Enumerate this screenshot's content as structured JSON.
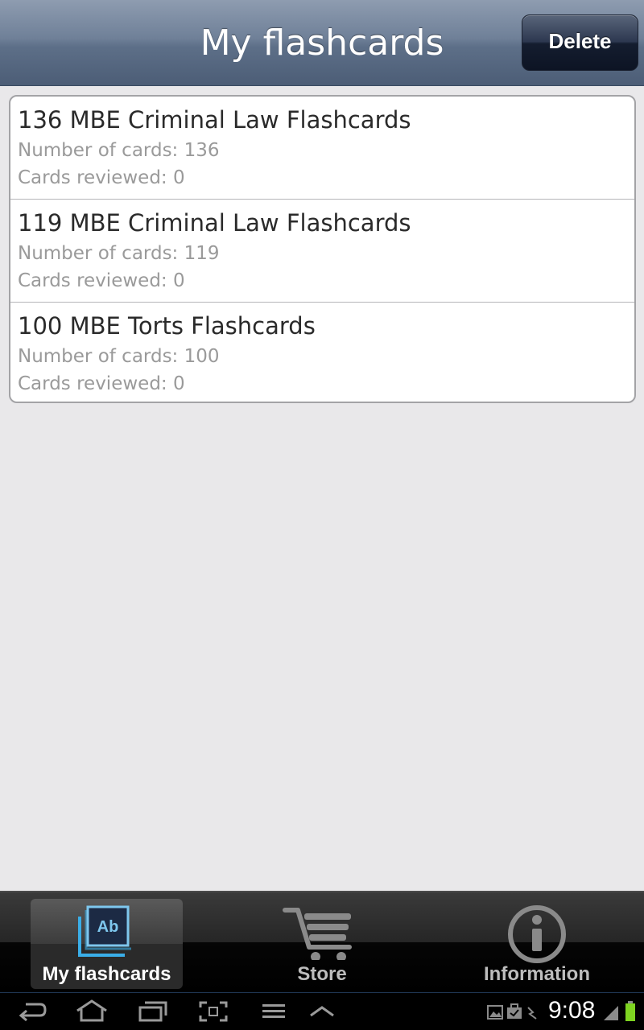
{
  "header": {
    "title": "My flashcards",
    "delete_label": "Delete"
  },
  "decks": [
    {
      "title": "136 MBE Criminal Law Flashcards",
      "count": "Number of cards: 136",
      "reviewed": "Cards reviewed: 0"
    },
    {
      "title": "119 MBE Criminal Law Flashcards",
      "count": "Number of cards: 119",
      "reviewed": "Cards reviewed: 0"
    },
    {
      "title": "100 MBE Torts Flashcards",
      "count": "Number of cards: 100",
      "reviewed": "Cards reviewed: 0"
    }
  ],
  "tabs": [
    {
      "label": "My flashcards",
      "icon": "flashcards-icon",
      "active": true
    },
    {
      "label": "Store",
      "icon": "cart-icon",
      "active": false
    },
    {
      "label": "Information",
      "icon": "info-icon",
      "active": false
    }
  ],
  "tab_icon_text": "Ab",
  "status": {
    "time": "9:08"
  },
  "colors": {
    "header": "#6f8098",
    "active_tab_label": "#ffffff",
    "inactive_tab_label": "#bdbdbd",
    "accent_icon": "#3aaee8",
    "battery": "#7ed321"
  }
}
